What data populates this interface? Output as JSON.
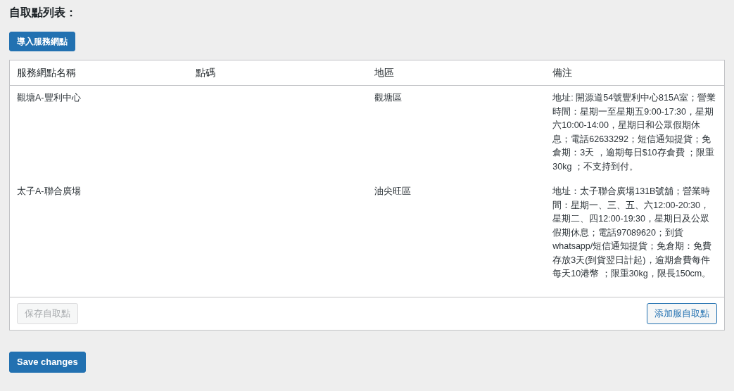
{
  "heading": "自取點列表：",
  "import_button": {
    "label": "導入服務網點"
  },
  "table": {
    "columns": [
      "服務網點名稱",
      "點碼",
      "地區",
      "備注"
    ],
    "rows": [
      {
        "name": "觀塘A-豐利中心",
        "region": "觀塘區",
        "note": "地址: 開源道54號豐利中心815A室；營業時間：星期一至星期五9:00-17:30，星期六10:00-14:00，星期日和公眾假期休息；電話62633292；短信通知提貨；免倉期：3天 ，逾期每日$10存倉費 ；限重30kg ；不支持到付。"
      },
      {
        "name": "太子A-聯合廣場",
        "region": "油尖旺區",
        "note": "地址：太子聯合廣場131B號舖；營業時間：星期一、三、五、六12:00-20:30，星期二、四12:00-19:30，星期日及公眾假期休息；電話97089620；到貨whatsapp/短信通知提貨；免倉期：免費存放3天(到貨翌日計起)，逾期倉費每件每天10港幣 ；限重30kg，限長150cm。"
      }
    ]
  },
  "footer_buttons": [
    {
      "label": "保存自取點",
      "disabled": true
    },
    {
      "label": "添加服自取點",
      "disabled": false
    }
  ],
  "submit_button": {
    "label": "Save changes"
  }
}
